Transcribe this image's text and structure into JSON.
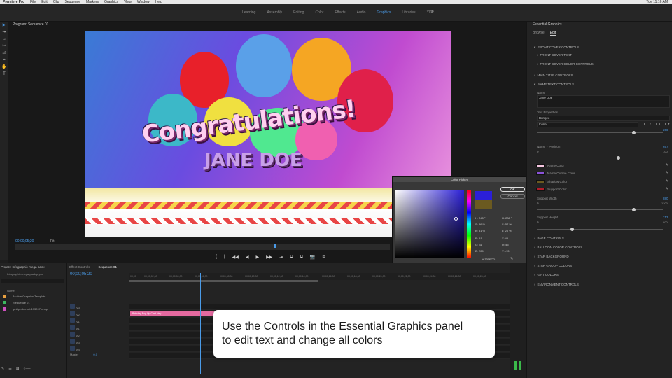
{
  "menubar": {
    "app": "Premiere Pro",
    "items": [
      "File",
      "Edit",
      "Clip",
      "Sequence",
      "Markers",
      "Graphics",
      "View",
      "Window",
      "Help"
    ],
    "clock": "Tue 11:16 AM"
  },
  "workspaces": {
    "tabs": [
      "Learning",
      "Assembly",
      "Editing",
      "Color",
      "Effects",
      "Audio",
      "Graphics",
      "Libraries",
      "YDP"
    ],
    "active": "Graphics",
    "more": "»"
  },
  "tools": [
    "▶",
    "⇥",
    "↔",
    "✂",
    "⇄",
    "✒",
    "✋",
    "T"
  ],
  "program": {
    "title": "Program: Sequence 01",
    "video_title": "Congratulations!",
    "video_name": "JANE DOE",
    "timecode": "00;00;05;20",
    "fit": "Fit",
    "transport": [
      "{",
      "|",
      "◀◀",
      "◀",
      "▶",
      "▶▶",
      "⇥",
      "⧉",
      "⧉",
      "📷",
      "⊞"
    ]
  },
  "essential_graphics": {
    "title": "Essential Graphics",
    "tabs": [
      "Browse",
      "Edit"
    ],
    "active_tab": "Edit",
    "sections_top": [
      "FRONT COVER CONTROLS",
      "FRONT COVER TEXT",
      "FRONT COVER COLOR CONTROLS",
      "MAIN TITLE CONTROLS",
      "NAME TEXT CONTROLS"
    ],
    "name_label": "Name",
    "name_value": "Jane Doe",
    "text_props_label": "Text Properties",
    "font": "Bungee",
    "style": "Inline",
    "font_size": "206",
    "name_y_label": "Name Y Position",
    "name_y_value": "657",
    "name_y_min": "0",
    "name_y_max": "700",
    "color_rows": [
      {
        "label": "Name Color",
        "color": "#f5c6e0"
      },
      {
        "label": "Name Outline Color",
        "color": "#8a52d8"
      },
      {
        "label": "Shadow Color",
        "color": "#6b5a20"
      },
      {
        "label": "Support Color",
        "color": "#b21d2a"
      }
    ],
    "support_width_label": "Support Width",
    "support_width_value": "880",
    "support_width_min": "0",
    "support_width_max": "1200",
    "support_height_label": "Support Height",
    "support_height_value": "213",
    "support_height_min": "0",
    "support_height_max": "800",
    "sections_bottom": [
      "PAGE CONTROLS",
      "BALLOON COLOR CONTROLS",
      "STAR BACKGROUND",
      "STAR GROUP COLORS",
      "GIFT COLORS",
      "ENVIRONMENT CONTROLS"
    ]
  },
  "color_picker": {
    "title": "Color Picker",
    "ok": "OK",
    "cancel": "Cancel",
    "left_values": [
      "H: 245 °",
      "S: 86 %",
      "B: 81 %",
      "R: 51",
      "G: 31",
      "B: 205"
    ],
    "right_values": [
      "H: 236 °",
      "S: 57 %",
      "L: 23 %",
      "Y: 45",
      "U: 45",
      "V: -13"
    ],
    "hex_label": "#",
    "hex": "331FCD",
    "web_colors": "Only Web Colors",
    "new_color": "#2b1fd8",
    "old_color": "#6b5a20"
  },
  "project": {
    "tab": "Project: Infographic-mega-pack",
    "file": "Infographic-mega-pack.prproj",
    "col_name": "Name",
    "items": [
      {
        "label": "Motion Graphics Template",
        "color": "#e8a040"
      },
      {
        "label": "Sequence 01",
        "color": "#3cb860"
      },
      {
        "label": "philipp-berndt-173097-unsp",
        "color": "#d050c0"
      }
    ]
  },
  "timeline": {
    "tabs": [
      "Effect Controls",
      "Sequence 01"
    ],
    "active_tab": "Sequence 01",
    "timecode": "00;00;05;20",
    "ruler": [
      "00;00",
      "00;00;02;00",
      "00;00;04;00",
      "00;00;06;00",
      "00;00;08;00",
      "00;00;10;00",
      "00;00;12;00",
      "00;00;14;00",
      "00;00;16;00",
      "00;00;18;00",
      "00;00;20;00",
      "00;00;22;00",
      "00;00;24;00",
      "00;00;26;00",
      "00;00;28;00"
    ],
    "tracks": [
      "V3",
      "V2",
      "V1",
      "A1",
      "A2",
      "A3",
      "A4",
      "Master"
    ],
    "master_value": "0.0",
    "clip": "Birthday Pop Up Card Hey"
  },
  "callout": {
    "line1": "Use the Controls in the Essential Graphics panel",
    "line2": "to edit text and change all colors"
  }
}
